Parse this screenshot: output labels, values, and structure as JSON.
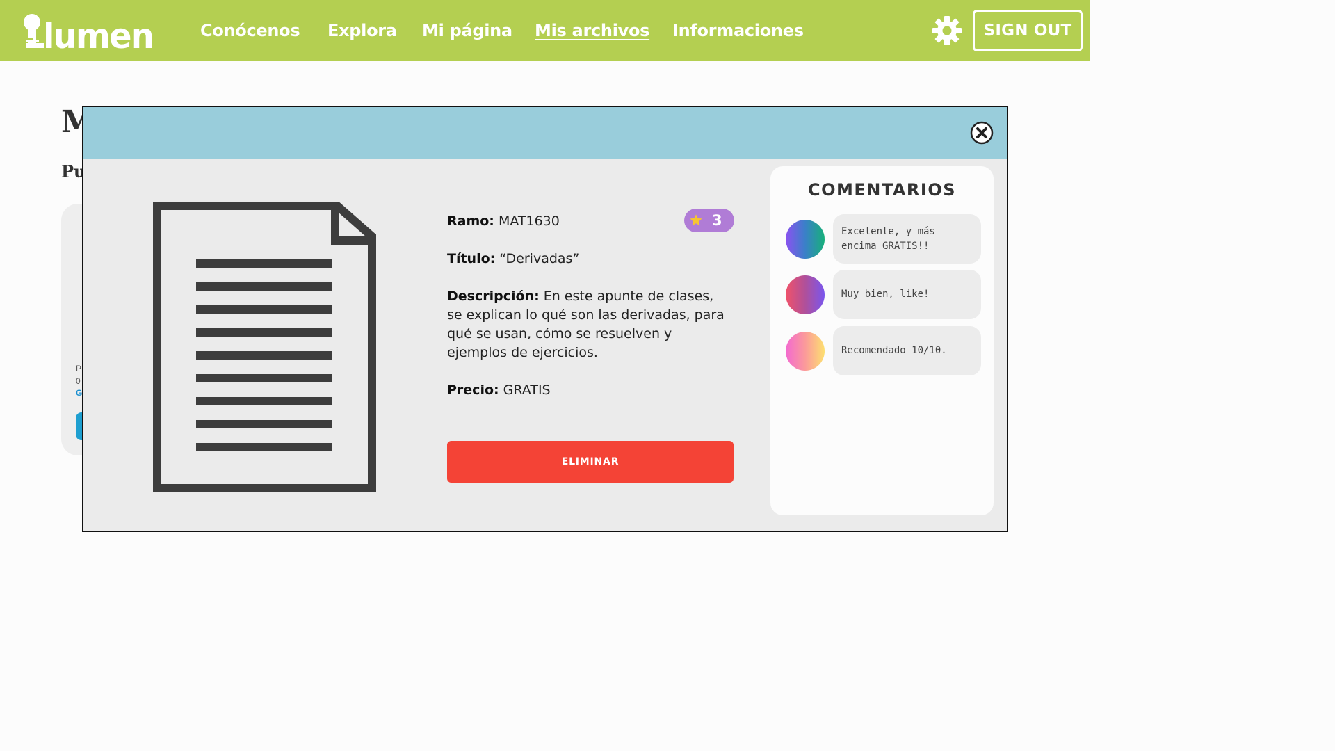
{
  "header": {
    "logo_text": "lumen",
    "nav": [
      "Conócenos",
      "Explora",
      "Mi página",
      "Mis archivos",
      "Informaciones"
    ],
    "active_nav": "Mis archivos",
    "settings_icon": "gear-icon",
    "signout_label": "SIGN OUT",
    "brand_color": "#b4cf51"
  },
  "background_page": {
    "title_fragment": "M",
    "subtitle_fragment": "Pu",
    "card_line1": "P",
    "card_line2": "0",
    "card_line3": "G"
  },
  "modal": {
    "close_icon": "close-circle-icon",
    "document_icon": "document-icon",
    "header_color": "#99cddb",
    "details": {
      "ramo_label": "Ramo:",
      "ramo_value": "MAT1630",
      "titulo_label": "Título:",
      "titulo_value": "“Derivadas”",
      "descripcion_label": "Descripción:",
      "descripcion_value": "En este apunte de clases, se explican lo qué son las derivadas, para qué se usan, cómo se resuelven y ejemplos de ejercicios.",
      "precio_label": "Precio:",
      "precio_value": "GRATIS"
    },
    "rating": {
      "icon": "star-icon",
      "value": "3"
    },
    "delete_label": "ELIMINAR",
    "delete_color": "#f44336",
    "comments": {
      "title": "COMENTARIOS",
      "items": [
        {
          "text": "Excelente, y más encima GRATIS!!"
        },
        {
          "text": "Muy bien, like!"
        },
        {
          "text": "Recomendado 10/10."
        }
      ]
    }
  }
}
